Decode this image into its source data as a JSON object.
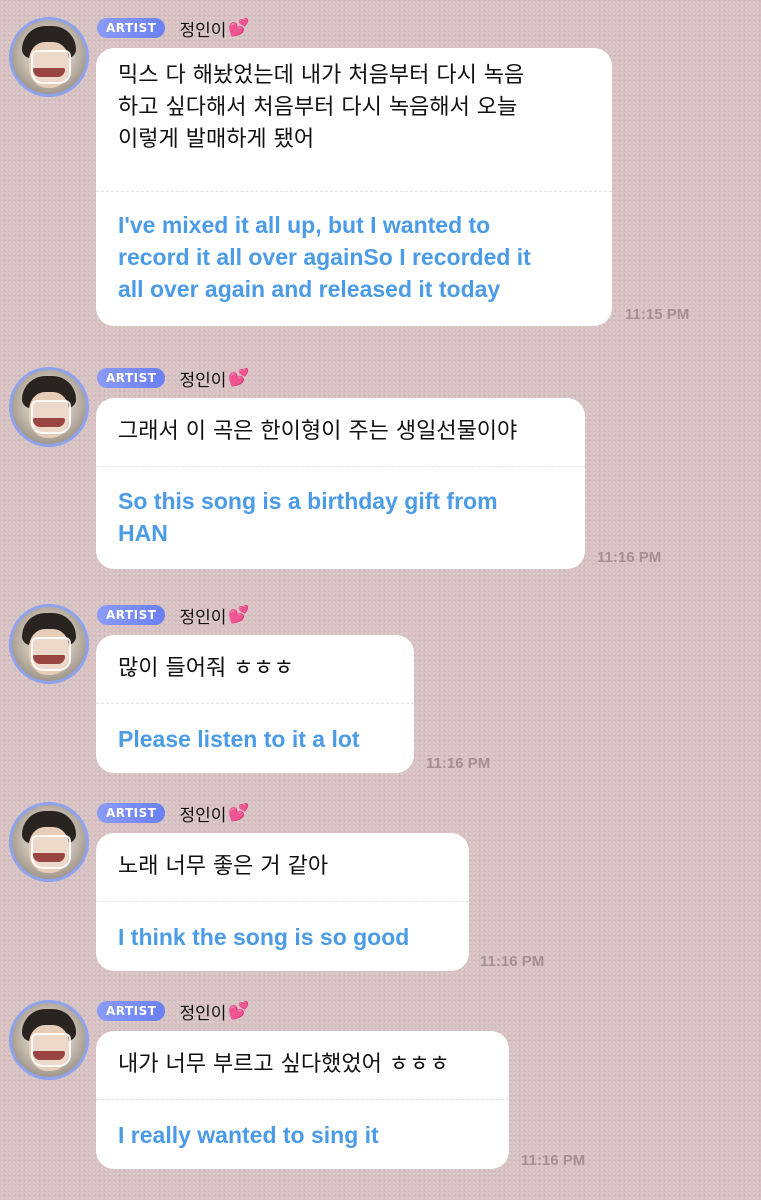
{
  "messages": [
    {
      "badge": "ARTIST",
      "name": "정인이",
      "heart": "💕",
      "korean_lines": [
        "믹스 다 해놨었는데 내가 처음부터 다시 녹음",
        "하고 싶다해서 처음부터 다시 녹음해서 오늘",
        "이렇게 발매하게 됐어"
      ],
      "english_lines": [
        "I've mixed it all up, but I wanted to",
        "record it all over againSo I recorded it",
        "all over again and released it today"
      ],
      "time": "11:15 PM"
    },
    {
      "badge": "ARTIST",
      "name": "정인이",
      "heart": "💕",
      "korean_lines": [
        "그래서 이 곡은 한이형이 주는 생일선물이야"
      ],
      "english_lines": [
        "So this song is a birthday gift from",
        "HAN"
      ],
      "time": "11:16 PM"
    },
    {
      "badge": "ARTIST",
      "name": "정인이",
      "heart": "💕",
      "korean_lines": [
        "많이 들어줘 ㅎㅎㅎ"
      ],
      "english_lines": [
        "Please listen to it a lot"
      ],
      "time": "11:16 PM"
    },
    {
      "badge": "ARTIST",
      "name": "정인이",
      "heart": "💕",
      "korean_lines": [
        "노래 너무 좋은 거 같아"
      ],
      "english_lines": [
        "I think the song is so good"
      ],
      "time": "11:16 PM"
    },
    {
      "badge": "ARTIST",
      "name": "정인이",
      "heart": "💕",
      "korean_lines": [
        "내가 너무 부르고 싶다했었어 ㅎㅎㅎ"
      ],
      "english_lines": [
        "I really wanted to sing it"
      ],
      "time": "11:16 PM"
    }
  ]
}
